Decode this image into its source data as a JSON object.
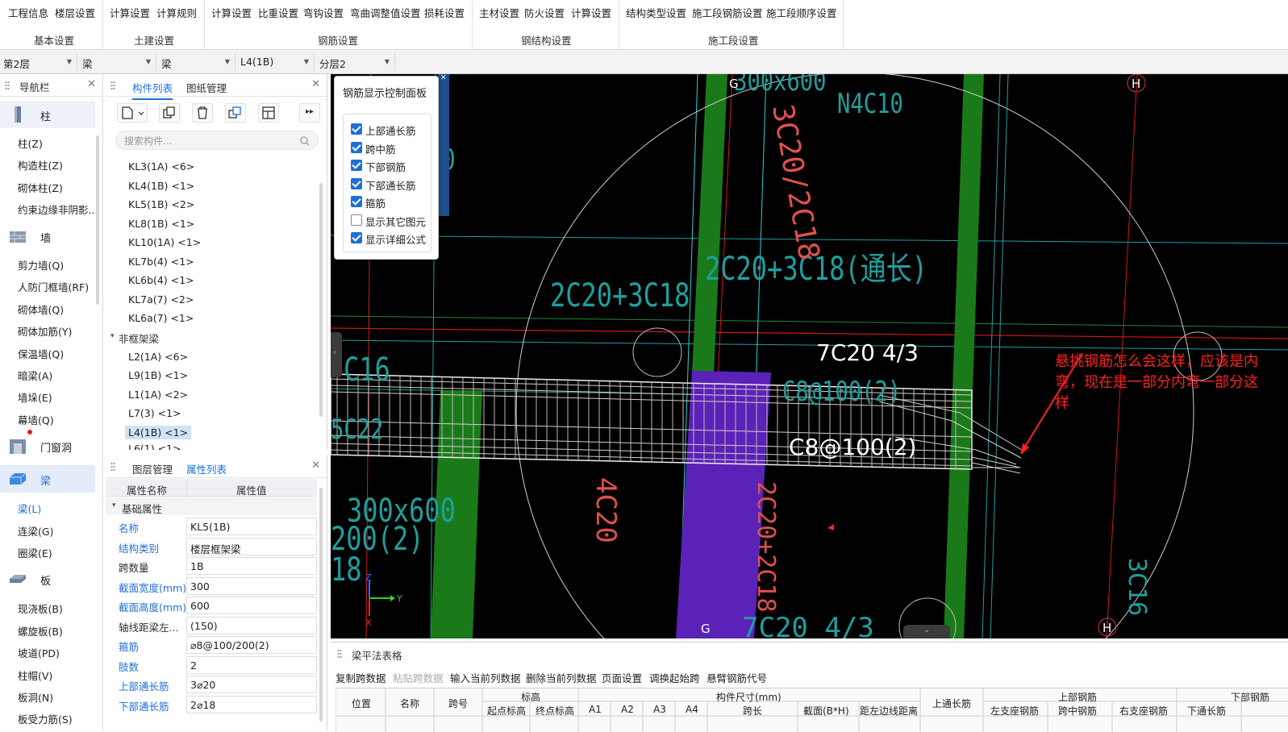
{
  "ribbon": {
    "groups": [
      {
        "title": "基本设置",
        "buttons": [
          "工程信息",
          "楼层设置"
        ]
      },
      {
        "title": "土建设置",
        "buttons": [
          "计算设置",
          "计算规则"
        ]
      },
      {
        "title": "钢筋设置",
        "buttons": [
          "计算设置",
          "比重设置",
          "弯钩设置",
          "弯曲调整值设置",
          "损耗设置"
        ]
      },
      {
        "title": "钢结构设置",
        "buttons": [
          "主材设置",
          "防火设置",
          "计算设置"
        ]
      },
      {
        "title": "施工段设置",
        "buttons": [
          "结构类型设置",
          "施工段钢筋设置",
          "施工段顺序设置"
        ]
      }
    ]
  },
  "selectors": [
    "第2层",
    "梁",
    "梁",
    "L4(1B)",
    "分层2"
  ],
  "nav": {
    "title": "导航栏",
    "categories": [
      {
        "label": "柱",
        "items": [
          "柱(Z)",
          "构造柱(Z)",
          "砌体柱(Z)",
          "约束边缘非阴影..."
        ]
      },
      {
        "label": "墙",
        "items": [
          "剪力墙(Q)",
          "人防门框墙(RF)",
          "砌体墙(Q)",
          "砌体加筋(Y)",
          "保温墙(Q)",
          "暗梁(A)",
          "墙垛(E)",
          "幕墙(Q)"
        ]
      },
      {
        "label": "门窗洞",
        "items": []
      },
      {
        "label": "梁",
        "items": [
          "梁(L)",
          "连梁(G)",
          "圈梁(E)"
        ]
      },
      {
        "label": "板",
        "items": [
          "现浇板(B)",
          "螺旋板(B)",
          "坡道(PD)",
          "柱帽(V)",
          "板洞(N)",
          "板受力筋(S)"
        ]
      }
    ]
  },
  "component_panel": {
    "tabs": [
      "构件列表",
      "图纸管理"
    ],
    "search_placeholder": "搜索构件...",
    "items": [
      "KL3(1A) <6>",
      "KL4(1B) <1>",
      "KL5(1B) <2>",
      "KL8(1B) <1>",
      "KL10(1A) <1>",
      "KL7b(4) <1>",
      "KL6b(4) <1>",
      "KL7a(7) <2>",
      "KL6a(7) <1>"
    ],
    "group_label": "非框架梁",
    "sub_items": [
      "L2(1A) <6>",
      "L9(1B) <1>",
      "L1(1A) <2>",
      "L7(3) <1>",
      "L4(1B) <1>",
      "L6(1) <1>"
    ],
    "selected": "L4(1B) <1>"
  },
  "property_panel": {
    "tabs": [
      "图层管理",
      "属性列表"
    ],
    "col_name": "属性名称",
    "col_value": "属性值",
    "section": "基础属性",
    "rows": [
      {
        "name": "名称",
        "value": "KL5(1B)",
        "blue": true
      },
      {
        "name": "结构类别",
        "value": "楼层框架梁",
        "blue": true
      },
      {
        "name": "跨数量",
        "value": "1B",
        "blue": false
      },
      {
        "name": "截面宽度(mm)",
        "value": "300",
        "blue": true
      },
      {
        "name": "截面高度(mm)",
        "value": "600",
        "blue": true
      },
      {
        "name": "轴线距梁左...",
        "value": "(150)",
        "blue": false
      },
      {
        "name": "箍筋",
        "value": "⌀8@100/200(2)",
        "blue": true
      },
      {
        "name": "肢数",
        "value": "2",
        "blue": true
      },
      {
        "name": "上部通长筋",
        "value": "3⌀20",
        "blue": true
      },
      {
        "name": "下部通长筋",
        "value": "2⌀18",
        "blue": true
      }
    ]
  },
  "rebar_panel": {
    "title": "钢筋显示控制面板",
    "options": [
      {
        "label": "上部通长筋",
        "checked": true
      },
      {
        "label": "跨中筋",
        "checked": true
      },
      {
        "label": "下部钢筋",
        "checked": true
      },
      {
        "label": "下部通长筋",
        "checked": true
      },
      {
        "label": "箍筋",
        "checked": true
      },
      {
        "label": "显示其它图元",
        "checked": false
      },
      {
        "label": "显示详细公式",
        "checked": true
      }
    ]
  },
  "canvas": {
    "axis_labels": [
      "G",
      "H",
      "G",
      "H"
    ],
    "texts": {
      "t1": "300x600",
      "t2": "N4C10",
      "t3": "3C20/2C18",
      "t4": "00",
      "t5": "2C20+3C18(通长)",
      "t6": "2C20+3C18",
      "t7": "7C20 4/3",
      "t8": "C8@100(2)",
      "t9": "C16",
      "t10": "5C22",
      "t11": "C8@100(2)",
      "t12": "300x600",
      "t13": "200(2)",
      "t14": "18",
      "t15": "2C20+2C18",
      "t16": "4C20",
      "t17": "3C16",
      "t18": "7C20 4/3"
    },
    "annotation": "悬挑钢筋怎么会这样，应该是内弯，现在是一部分内弯一部分这样",
    "colors": {
      "green": "#1a7a1a",
      "purple": "#5a22b8",
      "cyan": "#2bd3d3",
      "red": "#ff2020",
      "pink": "#e05050",
      "teal": "#1f9f9f"
    }
  },
  "bottom": {
    "title": "梁平法表格",
    "toolbar": [
      {
        "label": "复制跨数据",
        "enabled": true
      },
      {
        "label": "粘贴跨数据",
        "enabled": false
      },
      {
        "label": "输入当前列数据",
        "enabled": true
      },
      {
        "label": "删除当前列数据",
        "enabled": true
      },
      {
        "label": "页面设置",
        "enabled": true
      },
      {
        "label": "调换起始跨",
        "enabled": true
      },
      {
        "label": "悬臂钢筋代号",
        "enabled": true
      }
    ],
    "headers": {
      "pos": "位置",
      "name": "名称",
      "span": "跨号",
      "elev": "标高",
      "start_elev": "起点标高",
      "end_elev": "终点标高",
      "dims": "构件尺寸(mm)",
      "a1": "A1",
      "a2": "A2",
      "a3": "A3",
      "a4": "A4",
      "span_len": "跨长",
      "section": "截面(B*H)",
      "offset": "距左边线距离",
      "top_through": "上通长筋",
      "top_rebar": "上部钢筋",
      "left_seat": "左支座钢筋",
      "mid": "跨中钢筋",
      "right_seat": "右支座钢筋",
      "bottom_rebar": "下部钢筋",
      "bottom_through": "下通长筋"
    }
  }
}
